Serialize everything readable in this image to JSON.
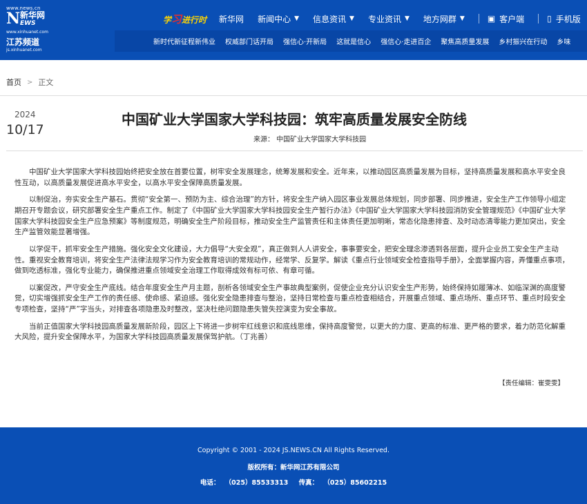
{
  "header": {
    "logo": {
      "url_top": "www.news.cn",
      "mark": "N",
      "cn": "新华网",
      "news": "EWS",
      "url_mid": "www.xinhuanet.com",
      "channel": "江苏频道",
      "url_bottom": "js.xinhuanet.com"
    },
    "xuexi": {
      "pre": "学",
      "big": "习",
      "post": "进行时"
    },
    "nav": [
      {
        "label": "新华网",
        "dropdown": false
      },
      {
        "label": "新闻中心",
        "dropdown": true
      },
      {
        "label": "信息资讯",
        "dropdown": true
      },
      {
        "label": "专业资讯",
        "dropdown": true
      },
      {
        "label": "地方网群",
        "dropdown": true
      }
    ],
    "client_label": "客户端",
    "mobile_label": "手机版",
    "subnav": [
      "新时代新征程新伟业",
      "权威部门话开局",
      "强信心·开新局",
      "这就是信心",
      "强信心·走进百企",
      "聚焦高质量发展",
      "乡村振兴在行动",
      "乡味"
    ]
  },
  "breadcrumb": {
    "home": "首页",
    "sep": ">",
    "current": "正文"
  },
  "date": {
    "year": "2024",
    "month_day": "10/17"
  },
  "article": {
    "title": "中国矿业大学国家大学科技园：筑牢高质量发展安全防线",
    "source": "来源：  中国矿业大学国家大学科技园",
    "paragraphs": [
      "中国矿业大学国家大学科技园始终把安全放在首要位置，树牢安全发展理念，统筹发展和安全。近年来，以推动园区高质量发展为目标，坚持高质量发展和高水平安全良性互动，以高质量发展促进高水平安全，以高水平安全保障高质量发展。",
      "以制促治，夯实安全生产基石。贯彻“安全第一、预防为主、综合治理”的方针，将安全生产纳入园区事业发展总体规划，同步部署、同步推进，安全生产工作领导小组定期召开专题会议，研究部署安全生产重点工作。制定了《中国矿业大学国家大学科技园安全生产暂行办法》《中国矿业大学国家大学科技园消防安全管理规范》《中国矿业大学国家大学科技园安全生产应急预案》等制度规范，明确安全生产阶段目标，推动安全生产监管责任和主体责任更加明晰，常态化隐患排查、及时动态清零能力更加突出，安全生产监管效能显著增强。",
      "以学促干，抓牢安全生产措施。强化安全文化建设，大力倡导“大安全观”，真正做到人人讲安全，事事要安全，把安全理念渗透到各层面，提升企业员工安全生产主动性。重视安全教育培训，将安全生产法律法规学习作为安全教育培训的常规动作，经常学、反复学。解读《重点行业领域安全检查指导手册》，全面掌握内容，弄懂重点事项，做到吃透标准，强化专业能力，确保推进重点领域安全治理工作取得成效有标可依、有章可循。",
      "以案促改，严守安全生产底线。结合年度安全生产月主题，剖析各领域安全生产事故典型案例，促使企业充分认识安全生产形势，始终保持如履薄冰、如临深渊的高度警觉，切实增强抓安全生产工作的责任感、使命感、紧迫感。强化安全隐患排查与整治，坚持日常检查与重点检查相结合，开展重点领域、重点场所、重点环节、重点时段安全专项检查，坚持“严”字当头，对排查各项隐患及时整改，坚决杜绝问题隐患失管失控演变为安全事故。",
      "当前正值国家大学科技园高质量发展新阶段，园区上下将进一步树牢红线意识和底线思维，保持高度警觉，以更大的力度、更高的标准、更严格的要求，着力防范化解重大风险，提升安全保障水平，为国家大学科技园高质量发展保驾护航。（丁兆善）"
    ],
    "editor": "【责任编辑：崔雯雯】"
  },
  "footer": {
    "copyright": "Copyright © 2001 - 2024 JS.NEWS.CN All Rights Reserved.",
    "owner": "版权所有：新华网江苏有限公司",
    "phone_label": "电话：",
    "phone1": "（025）85533313",
    "fax_label": "传真：",
    "phone2": "（025）85602215"
  }
}
